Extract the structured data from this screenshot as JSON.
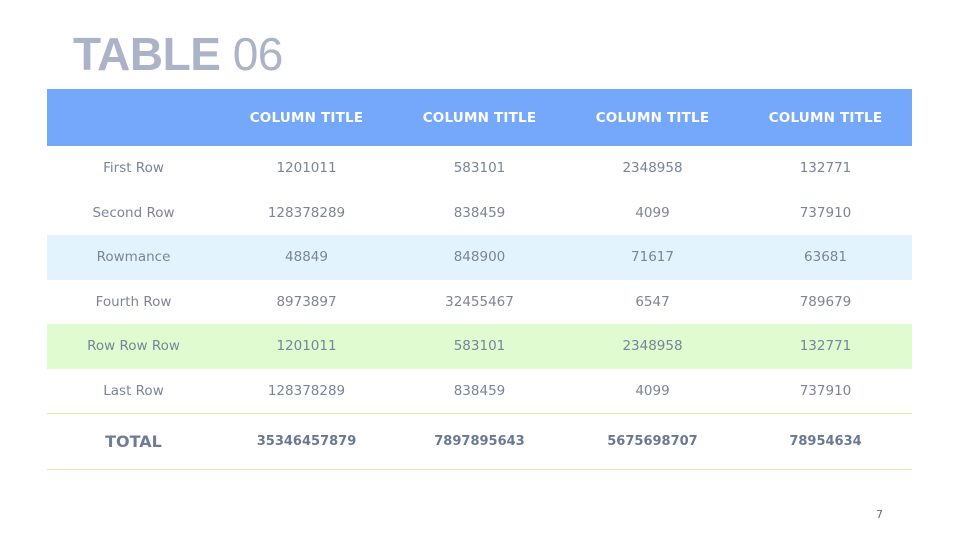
{
  "title": {
    "bold": "TABLE",
    "light": "06"
  },
  "table": {
    "headers": [
      "",
      "COLUMN TITLE",
      "COLUMN TITLE",
      "COLUMN TITLE",
      "COLUMN TITLE"
    ],
    "rows": [
      {
        "label": "First Row",
        "values": [
          "1201011",
          "583101",
          "2348958",
          "132771"
        ],
        "style": "plain"
      },
      {
        "label": "Second Row",
        "values": [
          "128378289",
          "838459",
          "4099",
          "737910"
        ],
        "style": "plain"
      },
      {
        "label": "Rowmance",
        "values": [
          "48849",
          "848900",
          "71617",
          "63681"
        ],
        "style": "blue"
      },
      {
        "label": "Fourth Row",
        "values": [
          "8973897",
          "32455467",
          "6547",
          "789679"
        ],
        "style": "plain"
      },
      {
        "label": "Row Row Row",
        "values": [
          "1201011",
          "583101",
          "2348958",
          "132771"
        ],
        "style": "green"
      },
      {
        "label": "Last Row",
        "values": [
          "128378289",
          "838459",
          "4099",
          "737910"
        ],
        "style": "plain"
      }
    ],
    "total": {
      "label": "TOTAL",
      "values": [
        "35346457879",
        "7897895643",
        "5675698707",
        "78954634"
      ]
    }
  },
  "colors": {
    "header_bg": "#75a8fa",
    "row_blue": "#e3f3fd",
    "row_green": "#dffbcf",
    "total_border": "#f3e2a8",
    "title": "#aab3c7"
  },
  "page_number": "7"
}
